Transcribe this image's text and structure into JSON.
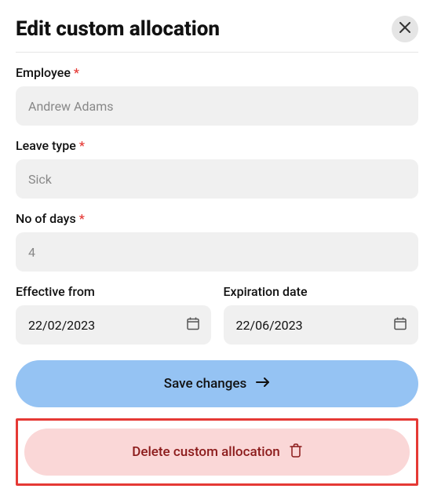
{
  "header": {
    "title": "Edit custom allocation"
  },
  "fields": {
    "employee": {
      "label": "Employee",
      "value": "Andrew Adams",
      "required": true
    },
    "leaveType": {
      "label": "Leave type",
      "value": "Sick",
      "required": true
    },
    "noOfDays": {
      "label": "No of days",
      "value": "4",
      "required": true
    },
    "effectiveFrom": {
      "label": "Effective from",
      "value": "22/02/2023",
      "required": false
    },
    "expirationDate": {
      "label": "Expiration date",
      "value": "22/06/2023",
      "required": false
    }
  },
  "buttons": {
    "save": "Save changes",
    "delete": "Delete custom allocation"
  }
}
